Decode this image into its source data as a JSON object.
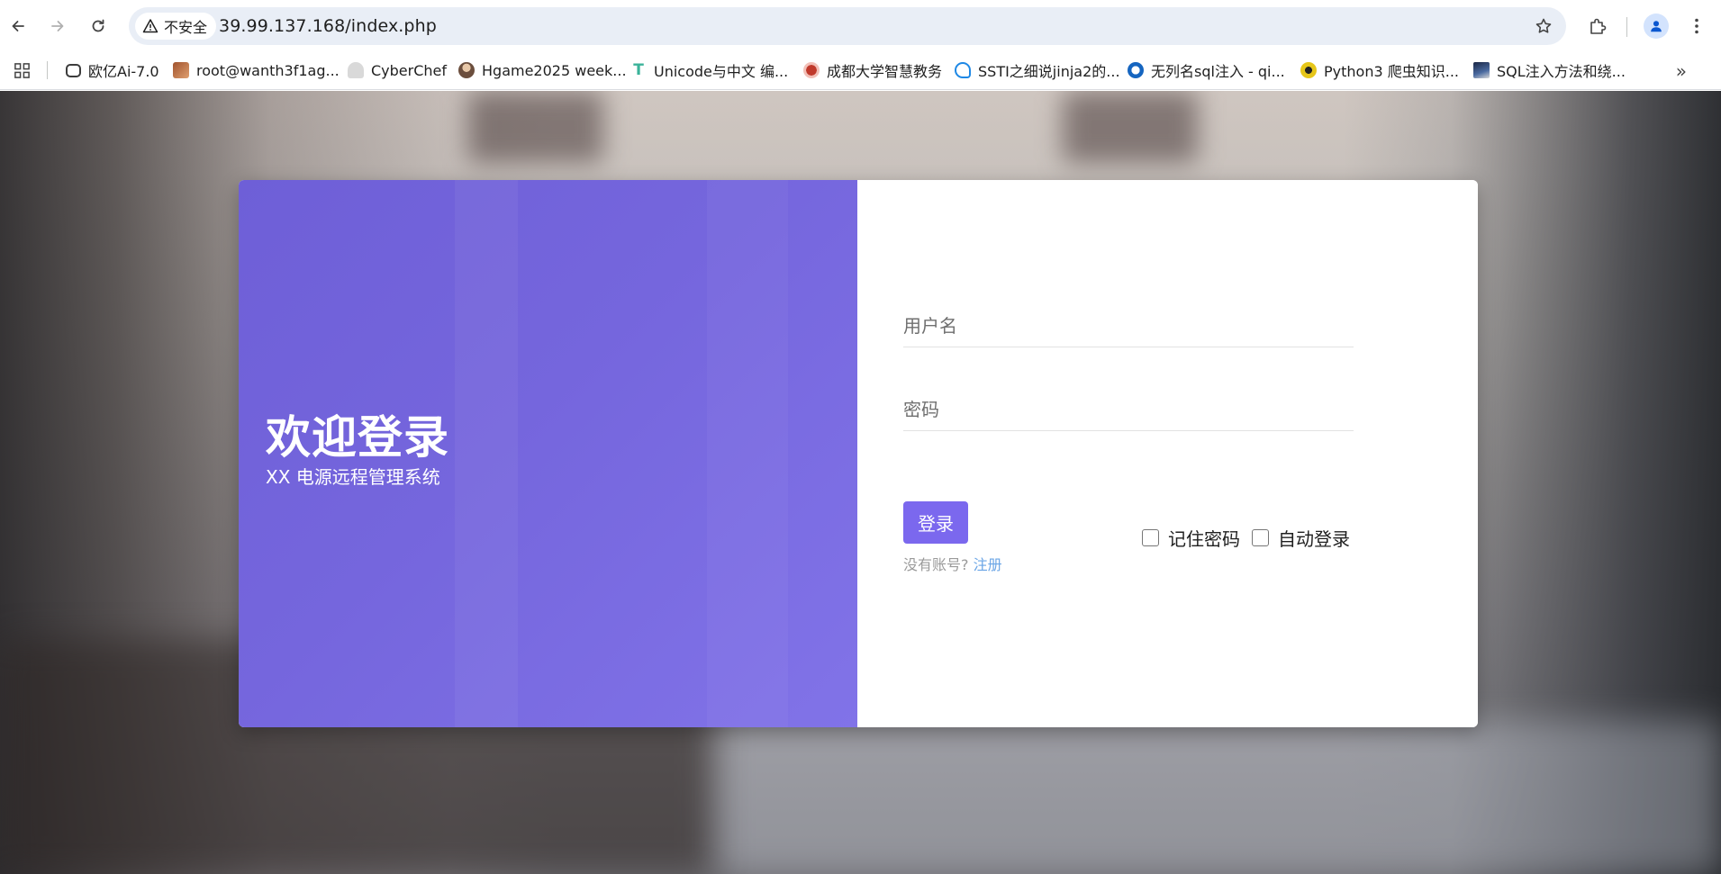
{
  "browser": {
    "security_label": "不安全",
    "url": "39.99.137.168/index.php",
    "bookmarks": [
      {
        "label": "欧亿Ai-7.0",
        "icon": "chat-bubble-icon",
        "color": "#3c3c3c"
      },
      {
        "label": "root@wanth3f1ag...",
        "icon": "avatar-photo-icon",
        "color": "#a0522d"
      },
      {
        "label": "CyberChef",
        "icon": "chef-hat-icon",
        "color": "#cfcfcf"
      },
      {
        "label": "Hgame2025 week...",
        "icon": "person-avatar-icon",
        "color": "#6b4e3d"
      },
      {
        "label": "Unicode与中文 编...",
        "icon": "teal-t-icon",
        "color": "#3bb39a"
      },
      {
        "label": "成都大学智慧教务",
        "icon": "university-seal-icon",
        "color": "#c0392b"
      },
      {
        "label": "SSTI之细说jinja2的...",
        "icon": "wifi-shield-icon",
        "color": "#1e88e5"
      },
      {
        "label": "无列名sql注入 - qi...",
        "icon": "blue-circle-icon",
        "color": "#1565c0"
      },
      {
        "label": "Python3 爬虫知识...",
        "icon": "biohazard-icon",
        "color": "#e6c619"
      },
      {
        "label": "SQL注入方法和绕...",
        "icon": "photo-thumb-icon",
        "color": "#2c3e66"
      }
    ]
  },
  "login": {
    "welcome_title": "欢迎登录",
    "welcome_subtitle": "XX 电源远程管理系统",
    "username_placeholder": "用户名",
    "password_placeholder": "密码",
    "login_button": "登录",
    "no_account_text": "没有账号?",
    "register_link": "注册",
    "remember_password": "记住密码",
    "auto_login": "自动登录",
    "accent_color": "#7b68ee"
  }
}
